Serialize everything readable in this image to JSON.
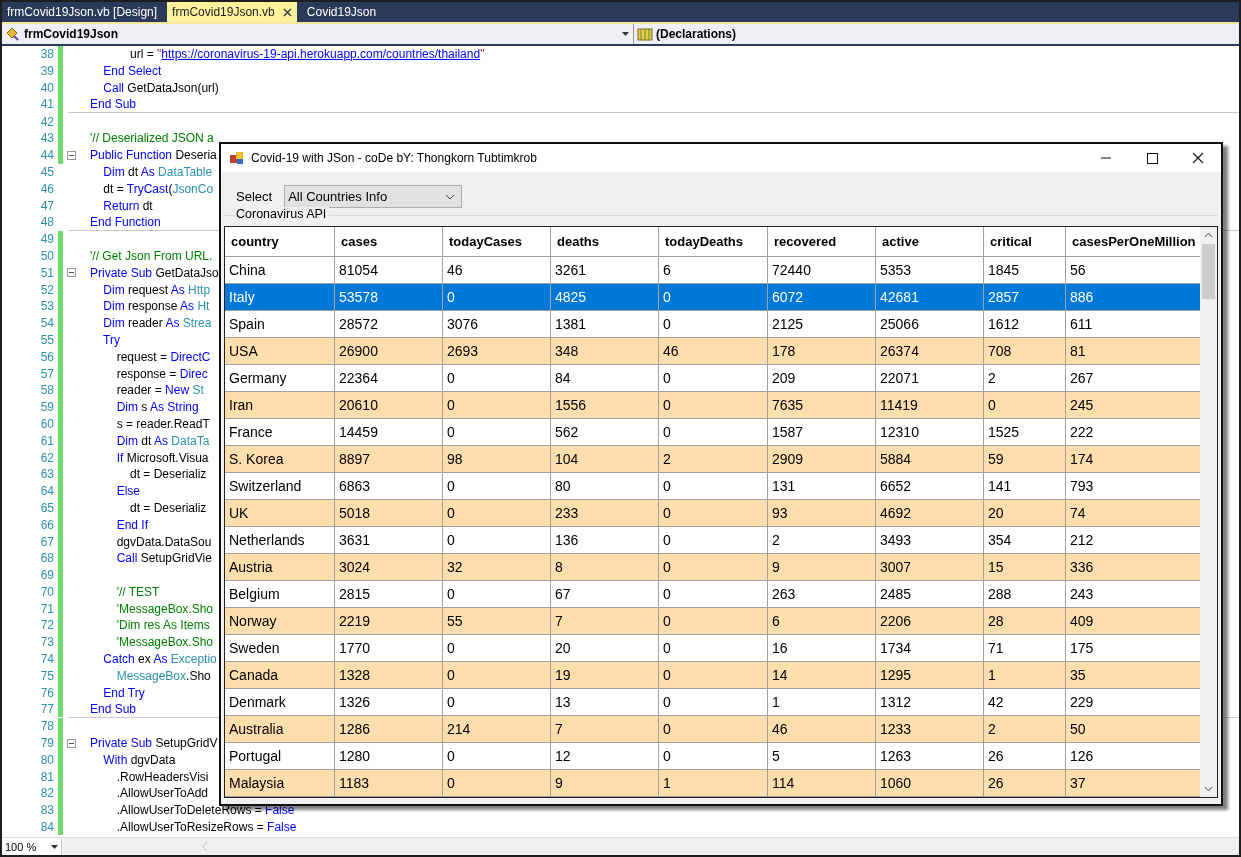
{
  "tabs": [
    {
      "label": "frmCovid19Json.vb [Design]",
      "selected": false,
      "closable": false
    },
    {
      "label": "frmCovid19Json.vb",
      "selected": true,
      "closable": true
    },
    {
      "label": "Covid19Json",
      "selected": false,
      "closable": false
    }
  ],
  "navigation": {
    "class_box": "frmCovid19Json",
    "member_box": "(Declarations)"
  },
  "code_lines": [
    {
      "number": "38",
      "changed": true,
      "collapse": false,
      "divider": false,
      "segments": [
        {
          "kind": "plain",
          "text": "            url = "
        },
        {
          "kind": "string",
          "text": "\""
        },
        {
          "kind": "link",
          "text": "https://coronavirus-19-api.herokuapp.com/countries/thailand"
        },
        {
          "kind": "string",
          "text": "\""
        }
      ]
    },
    {
      "number": "39",
      "changed": true,
      "collapse": false,
      "divider": false,
      "segments": [
        {
          "kind": "keyword",
          "text": "    End Select"
        }
      ]
    },
    {
      "number": "40",
      "changed": true,
      "collapse": false,
      "divider": false,
      "segments": [
        {
          "kind": "keyword",
          "text": "    Call"
        },
        {
          "kind": "plain",
          "text": " GetDataJson(url)"
        }
      ]
    },
    {
      "number": "41",
      "changed": true,
      "collapse": false,
      "divider": true,
      "segments": [
        {
          "kind": "keyword",
          "text": "End Sub"
        }
      ]
    },
    {
      "number": "42",
      "changed": true,
      "collapse": false,
      "divider": false
    },
    {
      "number": "43",
      "changed": true,
      "collapse": false,
      "divider": false,
      "segments": [
        {
          "kind": "comment",
          "text": "'// Deserialized JSON a"
        }
      ]
    },
    {
      "number": "44",
      "changed": true,
      "collapse": true,
      "divider": false,
      "segments": [
        {
          "kind": "keyword",
          "text": "Public Function"
        },
        {
          "kind": "plain",
          "text": " Deseria"
        }
      ]
    },
    {
      "number": "45",
      "changed": false,
      "collapse": false,
      "divider": false,
      "segments": [
        {
          "kind": "keyword",
          "text": "    Dim"
        },
        {
          "kind": "plain",
          "text": " dt "
        },
        {
          "kind": "keyword",
          "text": "As"
        },
        {
          "kind": "type",
          "text": " DataTable"
        }
      ]
    },
    {
      "number": "46",
      "changed": false,
      "collapse": false,
      "divider": false,
      "segments": [
        {
          "kind": "plain",
          "text": "    dt = "
        },
        {
          "kind": "keyword",
          "text": "TryCast"
        },
        {
          "kind": "plain",
          "text": "("
        },
        {
          "kind": "type",
          "text": "JsonCo"
        }
      ]
    },
    {
      "number": "47",
      "changed": false,
      "collapse": false,
      "divider": false,
      "segments": [
        {
          "kind": "keyword",
          "text": "    Return"
        },
        {
          "kind": "plain",
          "text": " dt"
        }
      ]
    },
    {
      "number": "48",
      "changed": false,
      "collapse": false,
      "divider": true,
      "segments": [
        {
          "kind": "keyword",
          "text": "End Function"
        }
      ]
    },
    {
      "number": "49",
      "changed": true,
      "collapse": false,
      "divider": false
    },
    {
      "number": "50",
      "changed": true,
      "collapse": false,
      "divider": false,
      "segments": [
        {
          "kind": "comment",
          "text": "'// Get Json From URL."
        }
      ]
    },
    {
      "number": "51",
      "changed": true,
      "collapse": true,
      "divider": false,
      "segments": [
        {
          "kind": "keyword",
          "text": "Private Sub"
        },
        {
          "kind": "plain",
          "text": " GetDataJso"
        }
      ]
    },
    {
      "number": "52",
      "changed": true,
      "collapse": false,
      "divider": false,
      "segments": [
        {
          "kind": "keyword",
          "text": "    Dim"
        },
        {
          "kind": "plain",
          "text": " request "
        },
        {
          "kind": "keyword",
          "text": "As"
        },
        {
          "kind": "type",
          "text": " Http"
        }
      ]
    },
    {
      "number": "53",
      "changed": true,
      "collapse": false,
      "divider": false,
      "segments": [
        {
          "kind": "keyword",
          "text": "    Dim"
        },
        {
          "kind": "plain",
          "text": " response "
        },
        {
          "kind": "keyword",
          "text": "As"
        },
        {
          "kind": "type",
          "text": " Ht"
        }
      ]
    },
    {
      "number": "54",
      "changed": true,
      "collapse": false,
      "divider": false,
      "segments": [
        {
          "kind": "keyword",
          "text": "    Dim"
        },
        {
          "kind": "plain",
          "text": " reader "
        },
        {
          "kind": "keyword",
          "text": "As"
        },
        {
          "kind": "type",
          "text": " Strea"
        }
      ]
    },
    {
      "number": "55",
      "changed": true,
      "collapse": false,
      "divider": false,
      "segments": [
        {
          "kind": "keyword",
          "text": "    Try"
        }
      ]
    },
    {
      "number": "56",
      "changed": true,
      "collapse": false,
      "divider": false,
      "segments": [
        {
          "kind": "plain",
          "text": "        request = "
        },
        {
          "kind": "keyword",
          "text": "DirectC"
        }
      ]
    },
    {
      "number": "57",
      "changed": true,
      "collapse": false,
      "divider": false,
      "segments": [
        {
          "kind": "plain",
          "text": "        response = "
        },
        {
          "kind": "keyword",
          "text": "Direc"
        }
      ]
    },
    {
      "number": "58",
      "changed": true,
      "collapse": false,
      "divider": false,
      "segments": [
        {
          "kind": "plain",
          "text": "        reader = "
        },
        {
          "kind": "keyword",
          "text": "New"
        },
        {
          "kind": "type",
          "text": " St"
        }
      ]
    },
    {
      "number": "59",
      "changed": true,
      "collapse": false,
      "divider": false,
      "segments": [
        {
          "kind": "keyword",
          "text": "        Dim"
        },
        {
          "kind": "plain",
          "text": " s "
        },
        {
          "kind": "keyword",
          "text": "As String"
        }
      ]
    },
    {
      "number": "60",
      "changed": true,
      "collapse": false,
      "divider": false,
      "segments": [
        {
          "kind": "plain",
          "text": "        s = reader.ReadT"
        }
      ]
    },
    {
      "number": "61",
      "changed": true,
      "collapse": false,
      "divider": false,
      "segments": [
        {
          "kind": "keyword",
          "text": "        Dim"
        },
        {
          "kind": "plain",
          "text": " dt "
        },
        {
          "kind": "keyword",
          "text": "As"
        },
        {
          "kind": "type",
          "text": " DataTa"
        }
      ]
    },
    {
      "number": "62",
      "changed": true,
      "collapse": false,
      "divider": false,
      "segments": [
        {
          "kind": "keyword",
          "text": "        If"
        },
        {
          "kind": "plain",
          "text": " Microsoft.Visua"
        }
      ]
    },
    {
      "number": "63",
      "changed": true,
      "collapse": false,
      "divider": false,
      "segments": [
        {
          "kind": "plain",
          "text": "            dt = Deserializ"
        }
      ]
    },
    {
      "number": "64",
      "changed": true,
      "collapse": false,
      "divider": false,
      "segments": [
        {
          "kind": "keyword",
          "text": "        Else"
        }
      ]
    },
    {
      "number": "65",
      "changed": true,
      "collapse": false,
      "divider": false,
      "segments": [
        {
          "kind": "plain",
          "text": "            dt = Deserializ"
        }
      ]
    },
    {
      "number": "66",
      "changed": true,
      "collapse": false,
      "divider": false,
      "segments": [
        {
          "kind": "keyword",
          "text": "        End If"
        }
      ]
    },
    {
      "number": "67",
      "changed": true,
      "collapse": false,
      "divider": false,
      "segments": [
        {
          "kind": "plain",
          "text": "        dgvData.DataSou"
        }
      ]
    },
    {
      "number": "68",
      "changed": true,
      "collapse": false,
      "divider": false,
      "segments": [
        {
          "kind": "keyword",
          "text": "        Call"
        },
        {
          "kind": "plain",
          "text": " SetupGridVie"
        }
      ]
    },
    {
      "number": "69",
      "changed": true,
      "collapse": false,
      "divider": false
    },
    {
      "number": "70",
      "changed": true,
      "collapse": false,
      "divider": false,
      "segments": [
        {
          "kind": "comment",
          "text": "        '// TEST"
        }
      ]
    },
    {
      "number": "71",
      "changed": true,
      "collapse": false,
      "divider": false,
      "segments": [
        {
          "kind": "comment",
          "text": "        'MessageBox.Sho"
        }
      ]
    },
    {
      "number": "72",
      "changed": true,
      "collapse": false,
      "divider": false,
      "segments": [
        {
          "kind": "comment",
          "text": "        'Dim res As Items"
        }
      ]
    },
    {
      "number": "73",
      "changed": true,
      "collapse": false,
      "divider": false,
      "segments": [
        {
          "kind": "comment",
          "text": "        'MessageBox.Sho"
        }
      ]
    },
    {
      "number": "74",
      "changed": true,
      "collapse": false,
      "divider": false,
      "segments": [
        {
          "kind": "keyword",
          "text": "    Catch"
        },
        {
          "kind": "plain",
          "text": " ex "
        },
        {
          "kind": "keyword",
          "text": "As"
        },
        {
          "kind": "type",
          "text": " Exceptio"
        }
      ]
    },
    {
      "number": "75",
      "changed": true,
      "collapse": false,
      "divider": false,
      "segments": [
        {
          "kind": "type",
          "text": "        MessageBox"
        },
        {
          "kind": "plain",
          "text": ".Sho"
        }
      ]
    },
    {
      "number": "76",
      "changed": true,
      "collapse": false,
      "divider": false,
      "segments": [
        {
          "kind": "keyword",
          "text": "    End Try"
        }
      ]
    },
    {
      "number": "77",
      "changed": true,
      "collapse": false,
      "divider": true,
      "segments": [
        {
          "kind": "keyword",
          "text": "End Sub"
        }
      ]
    },
    {
      "number": "78",
      "changed": true,
      "collapse": false,
      "divider": false
    },
    {
      "number": "79",
      "changed": true,
      "collapse": true,
      "divider": false,
      "segments": [
        {
          "kind": "keyword",
          "text": "Private Sub"
        },
        {
          "kind": "plain",
          "text": " SetupGridV"
        }
      ]
    },
    {
      "number": "80",
      "changed": true,
      "collapse": false,
      "divider": false,
      "segments": [
        {
          "kind": "keyword",
          "text": "    With"
        },
        {
          "kind": "plain",
          "text": " dgvData"
        }
      ]
    },
    {
      "number": "81",
      "changed": true,
      "collapse": false,
      "divider": false,
      "segments": [
        {
          "kind": "plain",
          "text": "        .RowHeadersVisi"
        }
      ]
    },
    {
      "number": "82",
      "changed": true,
      "collapse": false,
      "divider": false,
      "segments": [
        {
          "kind": "plain",
          "text": "        .AllowUserToAdd"
        }
      ]
    },
    {
      "number": "83",
      "changed": true,
      "collapse": false,
      "divider": false,
      "segments": [
        {
          "kind": "plain",
          "text": "        .AllowUserToDeleteRows = "
        },
        {
          "kind": "keyword",
          "text": "False"
        }
      ]
    },
    {
      "number": "84",
      "changed": true,
      "collapse": false,
      "divider": false,
      "segments": [
        {
          "kind": "plain",
          "text": "        .AllowUserToResizeRows = "
        },
        {
          "kind": "keyword",
          "text": "False"
        }
      ]
    }
  ],
  "zoom": "100 %",
  "window": {
    "title": "Covid-19 with JSon - coDe bY: Thongkorn Tubtimkrob",
    "select_label": "Select",
    "select_value": "All Countries Info",
    "group_title": "Coronavirus API",
    "table": {
      "columns": [
        "country",
        "cases",
        "todayCases",
        "deaths",
        "todayDeaths",
        "recovered",
        "active",
        "critical",
        "casesPerOneMillion"
      ],
      "rows": [
        {
          "cells": [
            "China",
            "81054",
            "46",
            "3261",
            "6",
            "72440",
            "5353",
            "1845",
            "56"
          ],
          "selected": false
        },
        {
          "cells": [
            "Italy",
            "53578",
            "0",
            "4825",
            "0",
            "6072",
            "42681",
            "2857",
            "886"
          ],
          "selected": true
        },
        {
          "cells": [
            "Spain",
            "28572",
            "3076",
            "1381",
            "0",
            "2125",
            "25066",
            "1612",
            "611"
          ],
          "selected": false
        },
        {
          "cells": [
            "USA",
            "26900",
            "2693",
            "348",
            "46",
            "178",
            "26374",
            "708",
            "81"
          ],
          "selected": false
        },
        {
          "cells": [
            "Germany",
            "22364",
            "0",
            "84",
            "0",
            "209",
            "22071",
            "2",
            "267"
          ],
          "selected": false
        },
        {
          "cells": [
            "Iran",
            "20610",
            "0",
            "1556",
            "0",
            "7635",
            "11419",
            "0",
            "245"
          ],
          "selected": false
        },
        {
          "cells": [
            "France",
            "14459",
            "0",
            "562",
            "0",
            "1587",
            "12310",
            "1525",
            "222"
          ],
          "selected": false
        },
        {
          "cells": [
            "S. Korea",
            "8897",
            "98",
            "104",
            "2",
            "2909",
            "5884",
            "59",
            "174"
          ],
          "selected": false
        },
        {
          "cells": [
            "Switzerland",
            "6863",
            "0",
            "80",
            "0",
            "131",
            "6652",
            "141",
            "793"
          ],
          "selected": false
        },
        {
          "cells": [
            "UK",
            "5018",
            "0",
            "233",
            "0",
            "93",
            "4692",
            "20",
            "74"
          ],
          "selected": false
        },
        {
          "cells": [
            "Netherlands",
            "3631",
            "0",
            "136",
            "0",
            "2",
            "3493",
            "354",
            "212"
          ],
          "selected": false
        },
        {
          "cells": [
            "Austria",
            "3024",
            "32",
            "8",
            "0",
            "9",
            "3007",
            "15",
            "336"
          ],
          "selected": false
        },
        {
          "cells": [
            "Belgium",
            "2815",
            "0",
            "67",
            "0",
            "263",
            "2485",
            "288",
            "243"
          ],
          "selected": false
        },
        {
          "cells": [
            "Norway",
            "2219",
            "55",
            "7",
            "0",
            "6",
            "2206",
            "28",
            "409"
          ],
          "selected": false
        },
        {
          "cells": [
            "Sweden",
            "1770",
            "0",
            "20",
            "0",
            "16",
            "1734",
            "71",
            "175"
          ],
          "selected": false
        },
        {
          "cells": [
            "Canada",
            "1328",
            "0",
            "19",
            "0",
            "14",
            "1295",
            "1",
            "35"
          ],
          "selected": false
        },
        {
          "cells": [
            "Denmark",
            "1326",
            "0",
            "13",
            "0",
            "1",
            "1312",
            "42",
            "229"
          ],
          "selected": false
        },
        {
          "cells": [
            "Australia",
            "1286",
            "214",
            "7",
            "0",
            "46",
            "1233",
            "2",
            "50"
          ],
          "selected": false
        },
        {
          "cells": [
            "Portugal",
            "1280",
            "0",
            "12",
            "0",
            "5",
            "1263",
            "26",
            "126"
          ],
          "selected": false
        },
        {
          "cells": [
            "Malaysia",
            "1183",
            "0",
            "9",
            "1",
            "114",
            "1060",
            "26",
            "37"
          ],
          "selected": false
        }
      ]
    }
  }
}
